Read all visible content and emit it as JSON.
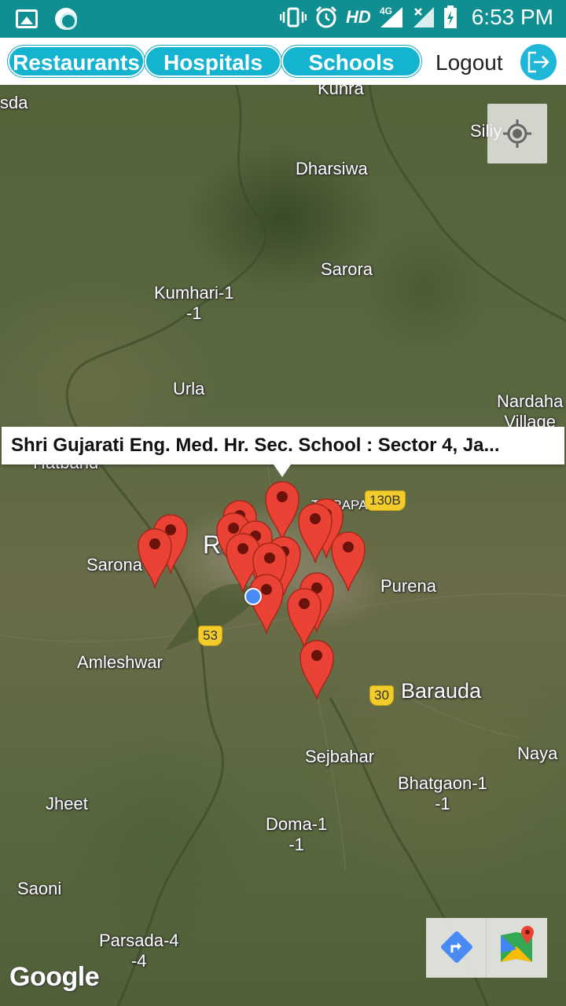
{
  "status_bar": {
    "network": "HD",
    "signal_label": "4G",
    "time": "6:53 PM",
    "icons": [
      "gallery-icon",
      "circle-app-icon",
      "vibrate-icon",
      "alarm-icon",
      "signal-icon",
      "no-signal-icon",
      "battery-charging-icon"
    ]
  },
  "toolbar": {
    "tabs": [
      "Restaurants",
      "Hospitals",
      "Schools"
    ],
    "logout_label": "Logout",
    "logout_icon": "exit-icon",
    "accent_color": "#14b3d0"
  },
  "map": {
    "callout_text": "Shri Gujarati Eng. Med. Hr. Sec. School : Sector 4, Ja...",
    "places": [
      {
        "name": "sda"
      },
      {
        "name": "Kunra"
      },
      {
        "name": "Siliy"
      },
      {
        "name": "Dharsiwa"
      },
      {
        "name": "Sarora"
      },
      {
        "name": "Kumhari-1\n-1"
      },
      {
        "name": "Urla"
      },
      {
        "name": "Nardaha\nVillage"
      },
      {
        "name": "Hatband"
      },
      {
        "name": "Sarona"
      },
      {
        "name": "Ra"
      },
      {
        "name": "TIKRAPARA"
      },
      {
        "name": "Purena"
      },
      {
        "name": "Amleshwar"
      },
      {
        "name": "Baraudа"
      },
      {
        "name": "Sejbahar"
      },
      {
        "name": "Naya"
      },
      {
        "name": "Bhatgaon-1\n-1"
      },
      {
        "name": "Jheet"
      },
      {
        "name": "Doma-1\n-1"
      },
      {
        "name": "Saoni"
      },
      {
        "name": "Parsada-4\n-4"
      }
    ],
    "road_shields": [
      "130B",
      "53",
      "30"
    ],
    "pin_color": "#ea4335",
    "user_location_color": "#4a8af4",
    "attribution": "Google"
  }
}
